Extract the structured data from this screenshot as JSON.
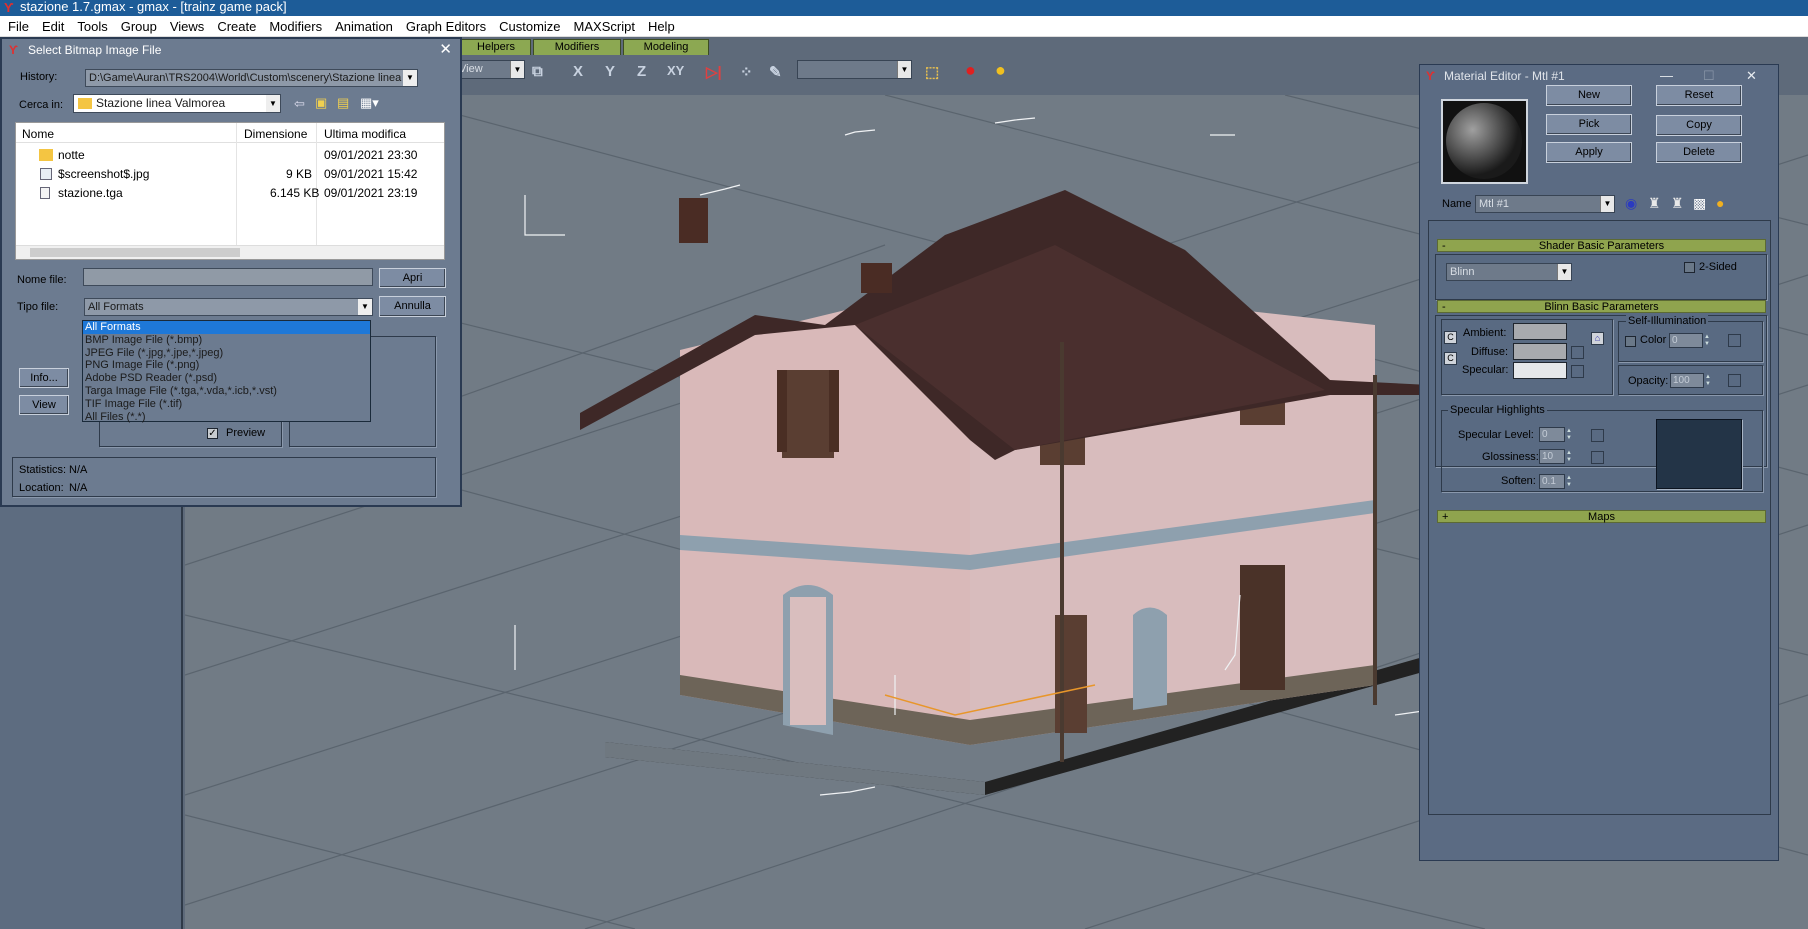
{
  "window": {
    "title": "stazione 1.7.gmax - gmax - [trainz game pack]"
  },
  "menu": [
    "File",
    "Edit",
    "Tools",
    "Group",
    "Views",
    "Create",
    "Modifiers",
    "Animation",
    "Graph Editors",
    "Customize",
    "MAXScript",
    "Help"
  ],
  "tabs": [
    "Helpers",
    "Modifiers",
    "Modeling"
  ],
  "toolbar": {
    "view_combo": "View",
    "selection_combo": ""
  },
  "bitmap_dialog": {
    "title": "Select Bitmap Image File",
    "history_label": "History:",
    "history_value": "D:\\Game\\Auran\\TRS2004\\World\\Custom\\scenery\\Stazione linea",
    "look_in_label": "Cerca in:",
    "look_in_value": "Stazione linea Valmorea",
    "columns": [
      "Nome",
      "Dimensione",
      "Ultima modifica"
    ],
    "files": [
      {
        "name": "notte",
        "size": "",
        "date": "09/01/2021 23:30",
        "icon": "folder-icon"
      },
      {
        "name": "$screenshot$.jpg",
        "size": "9 KB",
        "date": "09/01/2021 15:42",
        "icon": "image-file-icon"
      },
      {
        "name": "stazione.tga",
        "size": "6.145 KB",
        "date": "09/01/2021 23:19",
        "icon": "tga-file-icon"
      }
    ],
    "filename_label": "Nome file:",
    "filename_value": "",
    "filetype_label": "Tipo file:",
    "filetype_value": "All Formats",
    "open_button": "Apri",
    "cancel_button": "Annulla",
    "info_button": "Info...",
    "view_button": "View",
    "preview_label": "Preview",
    "preview_checked": true,
    "statistics_label": "Statistics:",
    "statistics_value": "N/A",
    "location_label": "Location:",
    "location_value": "N/A",
    "filetype_options": [
      "All Formats",
      "BMP Image File (*.bmp)",
      "JPEG File (*.jpg,*.jpe,*.jpeg)",
      "PNG Image File (*.png)",
      "Adobe PSD Reader (*.psd)",
      "Targa Image File (*.tga,*.vda,*.icb,*.vst)",
      "TIF Image File (*.tif)",
      "All Files (*.*)"
    ]
  },
  "material_editor": {
    "title": "Material Editor - Mtl #1",
    "buttons": {
      "new": "New",
      "reset": "Reset",
      "pick": "Pick",
      "copy": "Copy",
      "apply": "Apply",
      "delete": "Delete"
    },
    "name_label": "Name",
    "name_value": "Mtl #1",
    "shader_header": "Shader Basic Parameters",
    "shader_value": "Blinn",
    "two_sided_label": "2-Sided",
    "blinn_header": "Blinn Basic Parameters",
    "self_illum_label": "Self-Illumination",
    "ambient_label": "Ambient:",
    "diffuse_label": "Diffuse:",
    "specular_label": "Specular:",
    "color_label": "Color",
    "color_value": "0",
    "opacity_label": "Opacity:",
    "opacity_value": "100",
    "spec_highlights_label": "Specular Highlights",
    "spec_level_label": "Specular Level:",
    "spec_level_value": "0",
    "glossiness_label": "Glossiness:",
    "glossiness_value": "10",
    "soften_label": "Soften:",
    "soften_value": "0.1",
    "maps_header": "Maps"
  }
}
